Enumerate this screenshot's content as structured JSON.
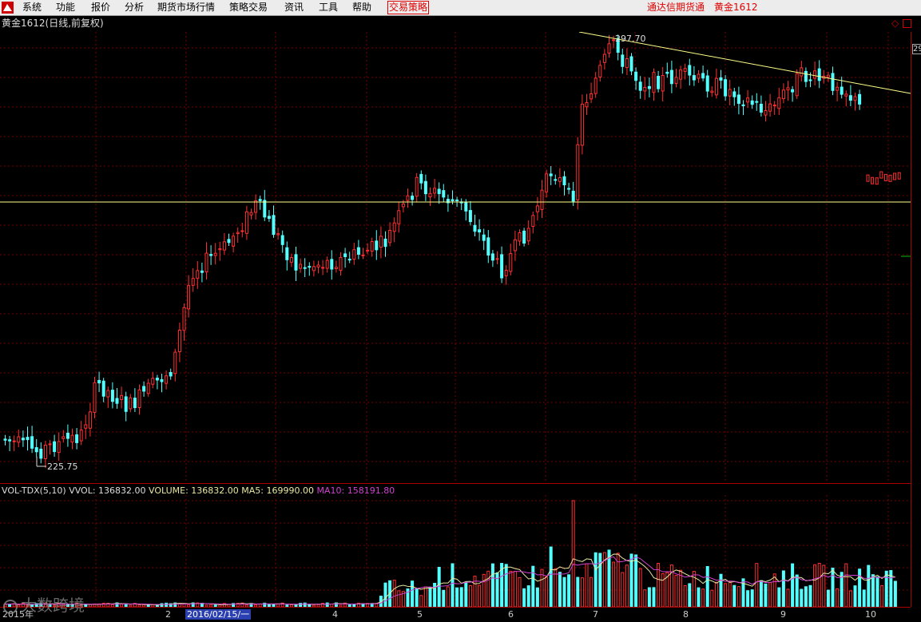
{
  "menubar": {
    "items": [
      "系统",
      "功能",
      "报价",
      "分析",
      "期货市场行情",
      "策略交易",
      "资讯",
      "工具",
      "帮助",
      "交易策略"
    ],
    "right_texts": [
      "通达信期货通",
      "黄金1612"
    ]
  },
  "chart": {
    "title": "黄金1612(日线,前复权)",
    "high_label": "297.70",
    "low_label": "225.75",
    "right_tag": "29",
    "colors": {
      "up": "#ff3030",
      "down": "#54ffff",
      "trend": "#ffff88",
      "grid": "#7a0000",
      "ma5": "#e8e8a0",
      "ma10": "#d040d0"
    }
  },
  "volume": {
    "name": "VOL-TDX(5,10)",
    "vvol": "VVOL: 136832.00",
    "volume": "VOLUME: 136832.00",
    "ma5": "MA5: 169990.00",
    "ma10": "MA10: 158191.80"
  },
  "date_axis": {
    "labels": [
      "2015年",
      "2",
      "4",
      "5",
      "6",
      "7",
      "8",
      "9",
      "10"
    ],
    "cursor": "2016/02/15/一"
  },
  "watermark": "大数跨境"
}
